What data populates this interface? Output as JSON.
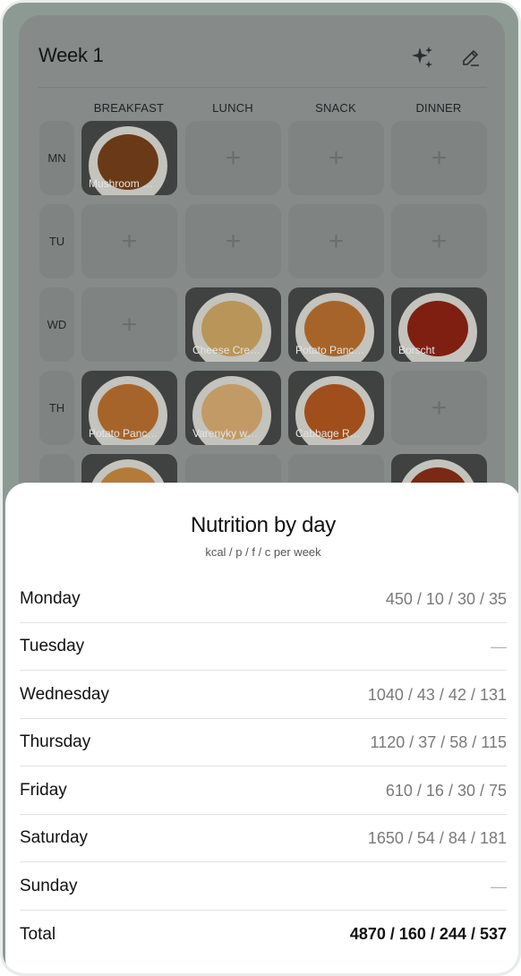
{
  "planner": {
    "title": "Week 1",
    "columns": [
      "BREAKFAST",
      "LUNCH",
      "SNACK",
      "DINNER"
    ],
    "days": [
      "MN",
      "TU",
      "WD",
      "TH"
    ],
    "add_symbol": "+",
    "meals": {
      "mn_breakfast": "Mushroom …",
      "wd_lunch": "Cheese Cre…",
      "wd_snack": "Potato Panc…",
      "wd_dinner": "Borscht",
      "th_breakfast": "Potato Panc…",
      "th_lunch": "Varenyky w…",
      "th_snack": "Cabbage R…"
    },
    "icons": {
      "sparkle": "sparkle-icon",
      "edit": "pencil-icon"
    }
  },
  "nutrition": {
    "title": "Nutrition by day",
    "subtitle": "kcal / p / f / c per week",
    "rows": [
      {
        "day": "Monday",
        "value": "450 / 10 / 30 / 35"
      },
      {
        "day": "Tuesday",
        "value": "—"
      },
      {
        "day": "Wednesday",
        "value": "1040 / 43 / 42 / 131"
      },
      {
        "day": "Thursday",
        "value": "1120 / 37 / 58 / 115"
      },
      {
        "day": "Friday",
        "value": "610 / 16 / 30 / 75"
      },
      {
        "day": "Saturday",
        "value": "1650 / 54 / 84 / 181"
      },
      {
        "day": "Sunday",
        "value": "—"
      }
    ],
    "total": {
      "label": "Total",
      "value": "4870 / 160 / 244 / 537"
    }
  },
  "colors": {
    "overlay": "#868b89",
    "sheet": "#ffffff",
    "text": "#111111",
    "muted": "#7a7a7a"
  }
}
